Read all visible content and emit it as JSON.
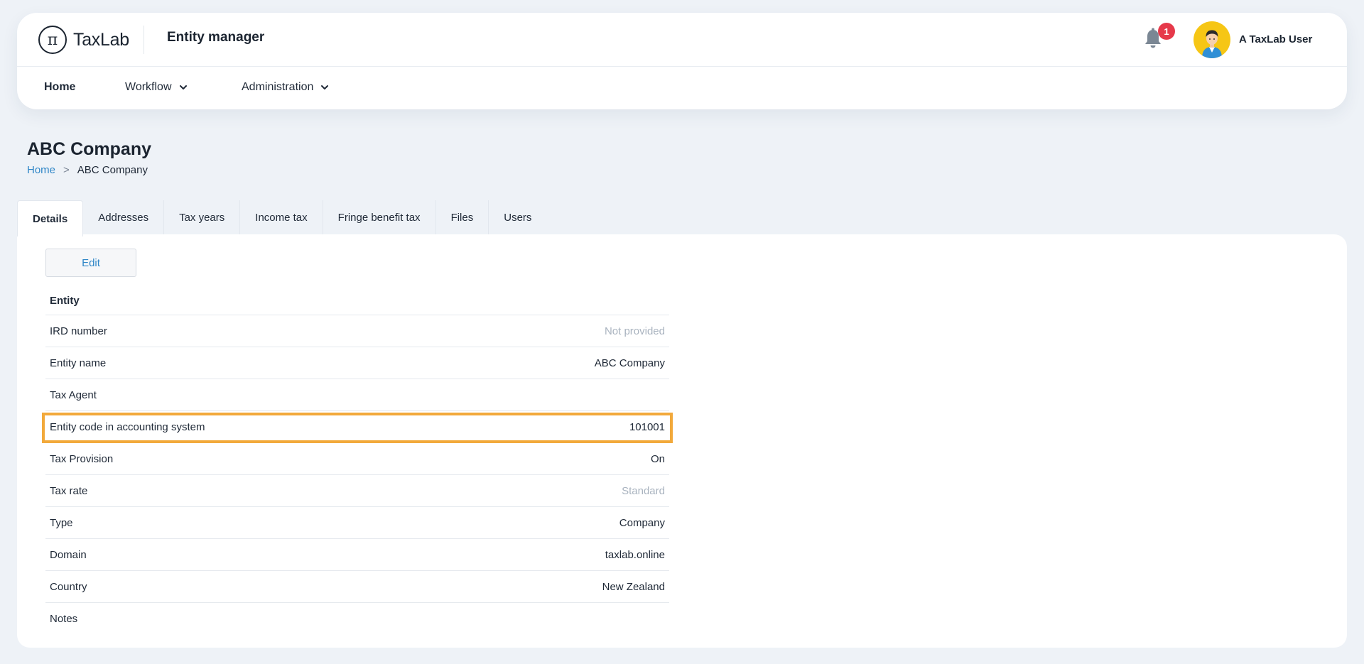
{
  "app": {
    "logo_glyph": "π",
    "logo_text": "TaxLab",
    "title": "Entity manager"
  },
  "notifications": {
    "count": "1",
    "icon": "bell-icon"
  },
  "user": {
    "name": "A TaxLab User",
    "avatar_bg": "#f6c615"
  },
  "nav": {
    "home": "Home",
    "workflow": "Workflow",
    "administration": "Administration"
  },
  "page": {
    "title": "ABC Company",
    "breadcrumb": {
      "home": "Home",
      "separator": ">",
      "current": "ABC Company"
    }
  },
  "tabs": [
    "Details",
    "Addresses",
    "Tax years",
    "Income tax",
    "Fringe benefit tax",
    "Files",
    "Users"
  ],
  "active_tab": "Details",
  "edit_label": "Edit",
  "details": {
    "section": "Entity",
    "rows": [
      {
        "label": "IRD number",
        "value": "Not provided"
      },
      {
        "label": "Entity name",
        "value": "ABC Company"
      },
      {
        "label": "Tax Agent",
        "value": ""
      },
      {
        "label": "Entity code in accounting system",
        "value": "101001"
      },
      {
        "label": "Tax Provision",
        "value": "On"
      },
      {
        "label": "Tax rate",
        "value": "Standard"
      },
      {
        "label": "Type",
        "value": "Company"
      },
      {
        "label": "Domain",
        "value": "taxlab.online"
      },
      {
        "label": "Country",
        "value": "New Zealand"
      },
      {
        "label": "Notes",
        "value": ""
      }
    ]
  },
  "colors": {
    "accent": "#2f86c7",
    "highlight": "#f2a93b",
    "badge": "#e6394a",
    "muted": "#a9b3bf"
  }
}
